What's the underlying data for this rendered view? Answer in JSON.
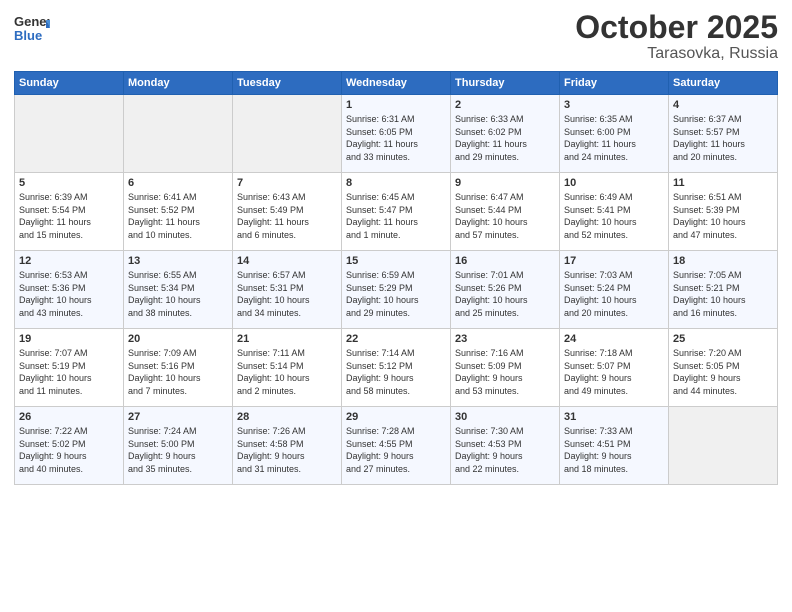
{
  "logo": {
    "line1": "General",
    "line2": "Blue"
  },
  "title": "October 2025",
  "location": "Tarasovka, Russia",
  "days_header": [
    "Sunday",
    "Monday",
    "Tuesday",
    "Wednesday",
    "Thursday",
    "Friday",
    "Saturday"
  ],
  "weeks": [
    [
      {
        "day": "",
        "info": ""
      },
      {
        "day": "",
        "info": ""
      },
      {
        "day": "",
        "info": ""
      },
      {
        "day": "1",
        "info": "Sunrise: 6:31 AM\nSunset: 6:05 PM\nDaylight: 11 hours\nand 33 minutes."
      },
      {
        "day": "2",
        "info": "Sunrise: 6:33 AM\nSunset: 6:02 PM\nDaylight: 11 hours\nand 29 minutes."
      },
      {
        "day": "3",
        "info": "Sunrise: 6:35 AM\nSunset: 6:00 PM\nDaylight: 11 hours\nand 24 minutes."
      },
      {
        "day": "4",
        "info": "Sunrise: 6:37 AM\nSunset: 5:57 PM\nDaylight: 11 hours\nand 20 minutes."
      }
    ],
    [
      {
        "day": "5",
        "info": "Sunrise: 6:39 AM\nSunset: 5:54 PM\nDaylight: 11 hours\nand 15 minutes."
      },
      {
        "day": "6",
        "info": "Sunrise: 6:41 AM\nSunset: 5:52 PM\nDaylight: 11 hours\nand 10 minutes."
      },
      {
        "day": "7",
        "info": "Sunrise: 6:43 AM\nSunset: 5:49 PM\nDaylight: 11 hours\nand 6 minutes."
      },
      {
        "day": "8",
        "info": "Sunrise: 6:45 AM\nSunset: 5:47 PM\nDaylight: 11 hours\nand 1 minute."
      },
      {
        "day": "9",
        "info": "Sunrise: 6:47 AM\nSunset: 5:44 PM\nDaylight: 10 hours\nand 57 minutes."
      },
      {
        "day": "10",
        "info": "Sunrise: 6:49 AM\nSunset: 5:41 PM\nDaylight: 10 hours\nand 52 minutes."
      },
      {
        "day": "11",
        "info": "Sunrise: 6:51 AM\nSunset: 5:39 PM\nDaylight: 10 hours\nand 47 minutes."
      }
    ],
    [
      {
        "day": "12",
        "info": "Sunrise: 6:53 AM\nSunset: 5:36 PM\nDaylight: 10 hours\nand 43 minutes."
      },
      {
        "day": "13",
        "info": "Sunrise: 6:55 AM\nSunset: 5:34 PM\nDaylight: 10 hours\nand 38 minutes."
      },
      {
        "day": "14",
        "info": "Sunrise: 6:57 AM\nSunset: 5:31 PM\nDaylight: 10 hours\nand 34 minutes."
      },
      {
        "day": "15",
        "info": "Sunrise: 6:59 AM\nSunset: 5:29 PM\nDaylight: 10 hours\nand 29 minutes."
      },
      {
        "day": "16",
        "info": "Sunrise: 7:01 AM\nSunset: 5:26 PM\nDaylight: 10 hours\nand 25 minutes."
      },
      {
        "day": "17",
        "info": "Sunrise: 7:03 AM\nSunset: 5:24 PM\nDaylight: 10 hours\nand 20 minutes."
      },
      {
        "day": "18",
        "info": "Sunrise: 7:05 AM\nSunset: 5:21 PM\nDaylight: 10 hours\nand 16 minutes."
      }
    ],
    [
      {
        "day": "19",
        "info": "Sunrise: 7:07 AM\nSunset: 5:19 PM\nDaylight: 10 hours\nand 11 minutes."
      },
      {
        "day": "20",
        "info": "Sunrise: 7:09 AM\nSunset: 5:16 PM\nDaylight: 10 hours\nand 7 minutes."
      },
      {
        "day": "21",
        "info": "Sunrise: 7:11 AM\nSunset: 5:14 PM\nDaylight: 10 hours\nand 2 minutes."
      },
      {
        "day": "22",
        "info": "Sunrise: 7:14 AM\nSunset: 5:12 PM\nDaylight: 9 hours\nand 58 minutes."
      },
      {
        "day": "23",
        "info": "Sunrise: 7:16 AM\nSunset: 5:09 PM\nDaylight: 9 hours\nand 53 minutes."
      },
      {
        "day": "24",
        "info": "Sunrise: 7:18 AM\nSunset: 5:07 PM\nDaylight: 9 hours\nand 49 minutes."
      },
      {
        "day": "25",
        "info": "Sunrise: 7:20 AM\nSunset: 5:05 PM\nDaylight: 9 hours\nand 44 minutes."
      }
    ],
    [
      {
        "day": "26",
        "info": "Sunrise: 7:22 AM\nSunset: 5:02 PM\nDaylight: 9 hours\nand 40 minutes."
      },
      {
        "day": "27",
        "info": "Sunrise: 7:24 AM\nSunset: 5:00 PM\nDaylight: 9 hours\nand 35 minutes."
      },
      {
        "day": "28",
        "info": "Sunrise: 7:26 AM\nSunset: 4:58 PM\nDaylight: 9 hours\nand 31 minutes."
      },
      {
        "day": "29",
        "info": "Sunrise: 7:28 AM\nSunset: 4:55 PM\nDaylight: 9 hours\nand 27 minutes."
      },
      {
        "day": "30",
        "info": "Sunrise: 7:30 AM\nSunset: 4:53 PM\nDaylight: 9 hours\nand 22 minutes."
      },
      {
        "day": "31",
        "info": "Sunrise: 7:33 AM\nSunset: 4:51 PM\nDaylight: 9 hours\nand 18 minutes."
      },
      {
        "day": "",
        "info": ""
      }
    ]
  ]
}
